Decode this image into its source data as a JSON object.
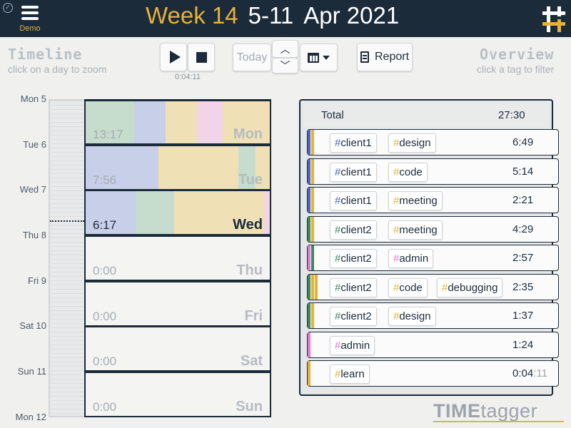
{
  "app": {
    "demo_label": "Demo",
    "brand_bold": "TIME",
    "brand_rest": "tagger"
  },
  "header": {
    "week_label": "Week 14",
    "date_range": "5-11",
    "month_year": "Apr 2021"
  },
  "toolbar": {
    "timeline_title": "Timeline",
    "timeline_hint": "click on a day to zoom",
    "timer_elapsed": "0:04:11",
    "today_label": "Today",
    "report_label": "Report",
    "overview_title": "Overview",
    "overview_hint": "click a tag to filter"
  },
  "timeline": {
    "day_labels": [
      "Mon 5",
      "Tue 6",
      "Wed 7",
      "Thu 8",
      "Fri 9",
      "Sat 10",
      "Sun 11",
      "Mon 12"
    ],
    "days": [
      {
        "name": "Mon",
        "duration": "13:17",
        "current": false
      },
      {
        "name": "Tue",
        "duration": "7:56",
        "current": false
      },
      {
        "name": "Wed",
        "duration": "6:17",
        "current": true
      },
      {
        "name": "Thu",
        "duration": "0:00",
        "current": false
      },
      {
        "name": "Fri",
        "duration": "0:00",
        "current": false
      },
      {
        "name": "Sat",
        "duration": "0:00",
        "current": false
      },
      {
        "name": "Sun",
        "duration": "0:00",
        "current": false
      }
    ]
  },
  "overview": {
    "total_label": "Total",
    "total_value": "27:30",
    "rows": [
      {
        "tags": [
          "client1",
          "design"
        ],
        "duration": "6:49",
        "duration_secs": ""
      },
      {
        "tags": [
          "client1",
          "code"
        ],
        "duration": "5:14",
        "duration_secs": ""
      },
      {
        "tags": [
          "client1",
          "meeting"
        ],
        "duration": "2:21",
        "duration_secs": ""
      },
      {
        "tags": [
          "client2",
          "meeting"
        ],
        "duration": "4:29",
        "duration_secs": ""
      },
      {
        "tags": [
          "client2",
          "admin"
        ],
        "duration": "2:57",
        "duration_secs": ""
      },
      {
        "tags": [
          "client2",
          "code",
          "debugging"
        ],
        "duration": "2:35",
        "duration_secs": ""
      },
      {
        "tags": [
          "client2",
          "design"
        ],
        "duration": "1:37",
        "duration_secs": ""
      },
      {
        "tags": [
          "admin"
        ],
        "duration": "1:24",
        "duration_secs": ""
      },
      {
        "tags": [
          "learn"
        ],
        "duration": "0:04",
        "duration_secs": ":11"
      }
    ]
  },
  "colors": {
    "header_bg": "#1b2b3a",
    "accent": "#e6b13b",
    "client1": "#4a64c8",
    "client2": "#3a8a5c",
    "admin": "#e27bd0",
    "activity": "#e6b13b"
  }
}
